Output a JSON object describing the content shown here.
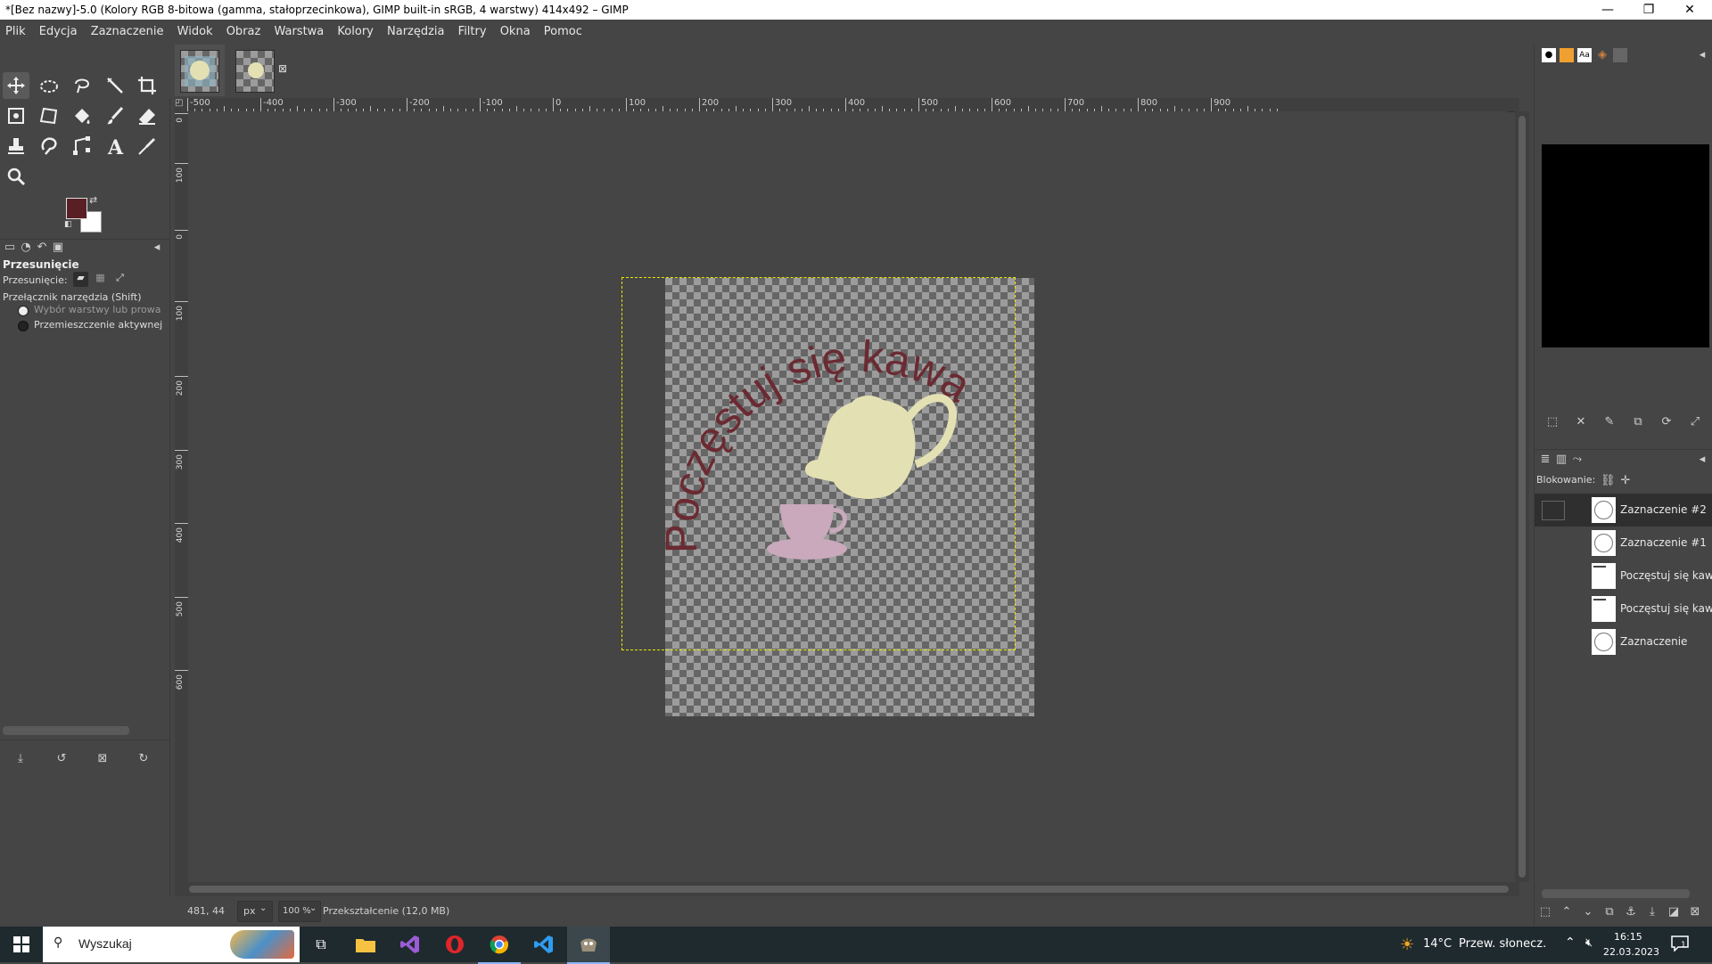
{
  "window": {
    "title": "*[Bez nazwy]-5.0 (Kolory RGB 8-bitowa (gamma, stałoprzecinkowa), GIMP built-in sRGB, 4 warstwy) 414x492 – GIMP",
    "minimize": "—",
    "maximize": "❐",
    "close": "✕"
  },
  "menu": [
    "Plik",
    "Edycja",
    "Zaznaczenie",
    "Widok",
    "Obraz",
    "Warstwa",
    "Kolory",
    "Narzędzia",
    "Filtry",
    "Okna",
    "Pomoc"
  ],
  "colors": {
    "foreground": "#5a1f24",
    "background": "#ffffff",
    "ui_bg": "#454545",
    "accent": "#5a5a5a"
  },
  "tool_options": {
    "title": "Przesunięcie",
    "mode_label": "Przesunięcie:",
    "switch_label": "Przełącznik narzędzia  (Shift)",
    "option1": "Wybór warstwy lub prowa",
    "option2": "Przemieszczenie aktywnej"
  },
  "ruler": {
    "h_labels": [
      "-500",
      "-400",
      "-300",
      "-200",
      "-100",
      "0",
      "100",
      "200",
      "300",
      "400",
      "500",
      "600",
      "700",
      "800",
      "900"
    ],
    "v_labels": [
      "0",
      "100",
      "0",
      "100",
      "200",
      "300",
      "400",
      "500",
      "600"
    ]
  },
  "image": {
    "arc_text": "Poczęstuj się kawą",
    "text_color": "#6b2a32",
    "teapot_color": "#e3e0b3",
    "cup_color": "#c9a9bb"
  },
  "statusbar": {
    "coords": "481, 44",
    "unit": "px",
    "zoom": "100 %",
    "message": "Przekształcenie (12,0 MB)"
  },
  "layers": {
    "lock_label": "Blokowanie:",
    "items": [
      {
        "name": "Zaznaczenie #2",
        "type": "circle",
        "selected": true
      },
      {
        "name": "Zaznaczenie #1",
        "type": "circle",
        "selected": false
      },
      {
        "name": "Poczęstuj się kaw",
        "type": "text",
        "selected": false
      },
      {
        "name": "Poczęstuj się kaw",
        "type": "text",
        "selected": false
      },
      {
        "name": "Zaznaczenie",
        "type": "circle",
        "selected": false
      }
    ]
  },
  "taskbar": {
    "search_placeholder": "Wyszukaj",
    "weather_temp": "14°C",
    "weather_desc": "Przew. słonecz.",
    "time": "16:15",
    "date": "22.03.2023",
    "notif_count": "1"
  }
}
